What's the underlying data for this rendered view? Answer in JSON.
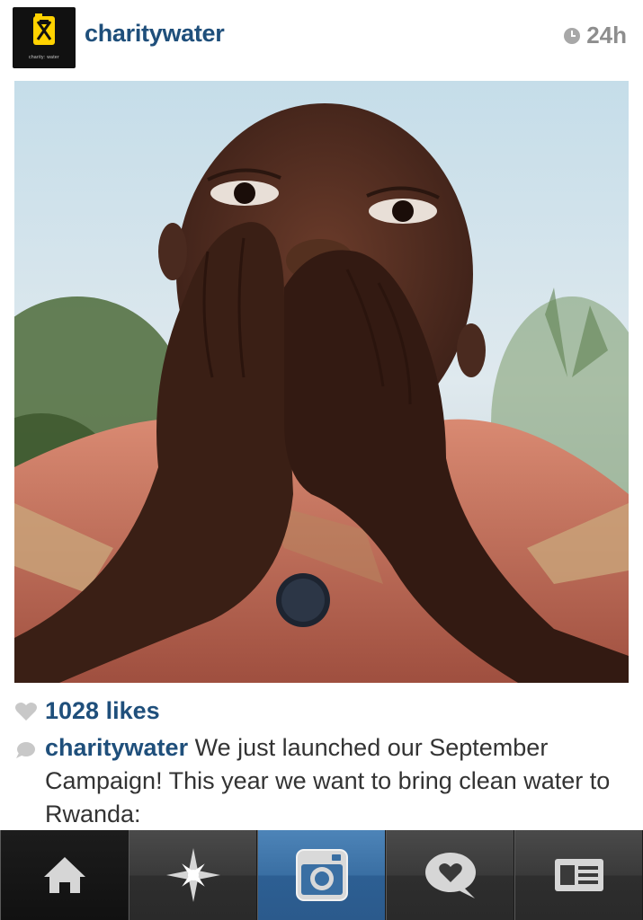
{
  "post": {
    "username": "charitywater",
    "time": "24h",
    "avatar_text": "charity: water",
    "likes": "1028 likes",
    "caption_user": "charitywater",
    "caption_text": " We just launched our September Campaign! This year we want to bring clean water to Rwanda:"
  },
  "icons": {
    "clock": "clock-icon",
    "heart": "heart-icon",
    "comment": "comment-icon",
    "home": "home-icon",
    "explore": "explore-icon",
    "camera": "camera-icon",
    "activity": "activity-icon",
    "profile": "profile-icon"
  },
  "colors": {
    "username": "#1f4f7b",
    "tab_active": "#3a6fa3",
    "tab_bar": "#2b2b2b",
    "logo_yellow": "#ffd200"
  }
}
